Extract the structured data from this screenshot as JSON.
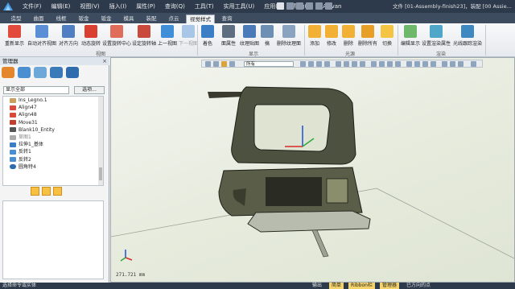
{
  "titlebar": {
    "menus": [
      "文件(F)",
      "编辑(E)",
      "视图(V)",
      "插入(I)",
      "属性(P)",
      "查询(Q)",
      "工具(T)",
      "实用工具(U)",
      "应用(A)",
      "帮助(H)",
      "Artvan"
    ],
    "doc_title": "文件 [01-Assembly-finish23]，装配 [00 Assie..."
  },
  "tabs": [
    "造型",
    "曲面",
    "线框",
    "钣金",
    "钣金",
    "模具",
    "装配",
    "点云",
    "视觉样式",
    "查询"
  ],
  "active_tab": "视觉样式",
  "ribbon": {
    "buttons": [
      "重新显示",
      "自动对齐视图",
      "对齐方向",
      "动态旋转",
      "设置旋转中心",
      "设定旋转轴",
      "上一视图",
      "下一视图",
      "着色",
      "面属性",
      "纹理贴图",
      "搞",
      "删除纹理面",
      "添加",
      "修改",
      "删除",
      "删除所有",
      "切换",
      "编辑显示",
      "设置渲染属性",
      "光线跟踪渲染"
    ],
    "groups": [
      "视图",
      "显示",
      "光源",
      "渲染"
    ]
  },
  "manager": {
    "title": "管理器",
    "close": "×",
    "filter_value": "显示全部",
    "filter_button": "选项...",
    "tree": [
      "Ins_Legno.1",
      "Align47",
      "Align48",
      "Move31",
      "Blank10_Entity",
      "草图1",
      "拉伸1_基体",
      "反转1",
      "反转2",
      "圆角特4"
    ]
  },
  "viewport": {
    "select_value": "所有",
    "coord": "271.721 mm"
  },
  "status": {
    "left": "选择命令或实体",
    "items": [
      "输出",
      "简单",
      "Ribbon栏",
      "管理器",
      "已方向的点"
    ]
  },
  "colors": {
    "titlebar": "#2d3a4c",
    "tabbar": "#3e4c60",
    "accent": "#f3d36a"
  }
}
